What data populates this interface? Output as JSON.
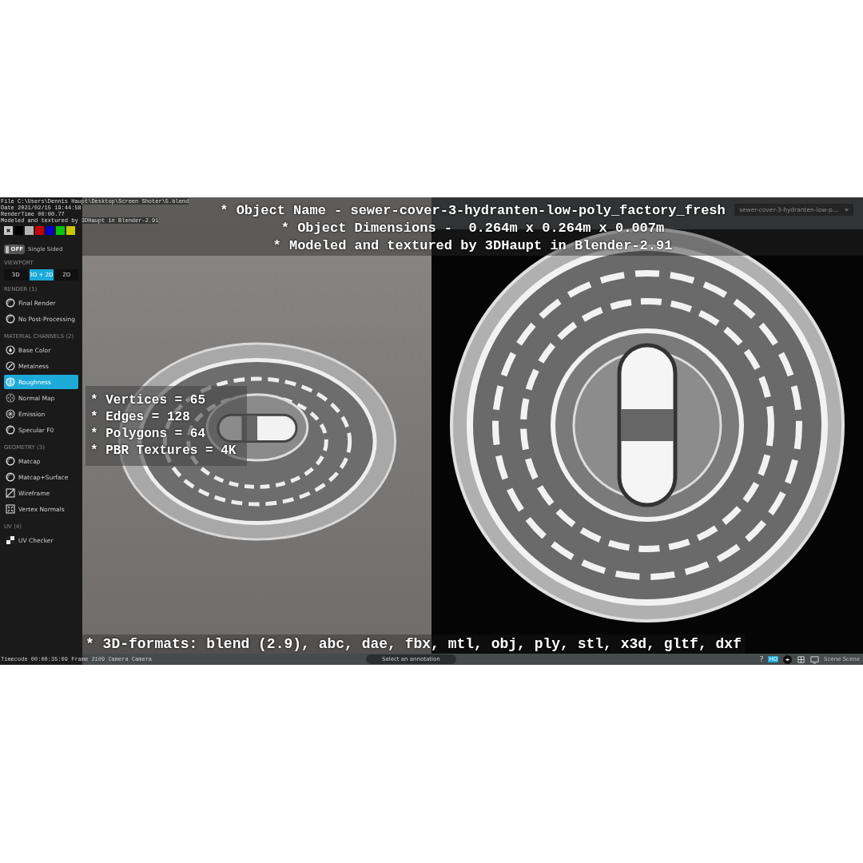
{
  "file_info": [
    "File C:\\Users\\Dennis Haupt\\Desktop\\Screen Shoter\\5.blend",
    "Date 2021/02/15 19:44:58",
    "RenderTime 00:00.77",
    "Modeled and textured by 3DHaupt in Blender-2.91"
  ],
  "sidebar": {
    "swatches": [
      {
        "kind": "close",
        "color": "#c8c8c8"
      },
      {
        "kind": "color",
        "color": "#000000"
      },
      {
        "kind": "color",
        "color": "#b4b4b4"
      },
      {
        "kind": "color",
        "color": "#c80000"
      },
      {
        "kind": "color",
        "color": "#0000c8"
      },
      {
        "kind": "color",
        "color": "#00c800"
      },
      {
        "kind": "color",
        "color": "#c8c800"
      }
    ],
    "toggle": {
      "label": "OFF",
      "on": false,
      "text": "Single Sided"
    },
    "sections": [
      {
        "heading": "VIEWPORT",
        "kind": "segmented",
        "items": [
          {
            "label": "3D",
            "selected": false
          },
          {
            "label": "3D + 2D",
            "selected": true
          },
          {
            "label": "2D",
            "selected": false
          }
        ]
      },
      {
        "heading": "RENDER (1)",
        "kind": "list",
        "items": [
          {
            "label": "Final Render",
            "kind": "ring",
            "selected": false
          },
          {
            "label": "No Post-Processing",
            "kind": "ring",
            "selected": false
          }
        ]
      },
      {
        "heading": "MATERIAL CHANNELS (2)",
        "kind": "list",
        "items": [
          {
            "label": "Base Color",
            "kind": "drop",
            "selected": false
          },
          {
            "label": "Metalness",
            "kind": "compass",
            "selected": false
          },
          {
            "label": "Roughness",
            "kind": "globe",
            "selected": true
          },
          {
            "label": "Normal Map",
            "kind": "dots",
            "selected": false
          },
          {
            "label": "Emission",
            "kind": "flower",
            "selected": false
          },
          {
            "label": "Specular F0",
            "kind": "ring",
            "selected": false
          }
        ]
      },
      {
        "heading": "GEOMETRY (3)",
        "kind": "list",
        "items": [
          {
            "label": "Matcap",
            "kind": "ring",
            "selected": false
          },
          {
            "label": "Matcap+Surface",
            "kind": "ring",
            "selected": false
          },
          {
            "label": "Wireframe",
            "kind": "diagonal",
            "selected": false
          },
          {
            "label": "Vertex Normals",
            "kind": "corners",
            "selected": false
          }
        ]
      },
      {
        "heading": "UV (4)",
        "kind": "list",
        "items": [
          {
            "label": "UV Checker",
            "kind": "checker",
            "selected": false
          }
        ]
      }
    ],
    "timecode": "Timecode 00:00:35:09   Frame 2109   Camera Camera"
  },
  "title_lines": [
    "* Object Name - sewer-cover-3-hydranten-low-poly_factory_fresh",
    "* Object Dimensions -  0.264m x 0.264m x 0.007m",
    "* Modeled and textured by 3DHaupt in Blender-2.91"
  ],
  "stats": [
    "* Vertices = 65",
    "* Edges = 128",
    "* Polygons = 64",
    "* PBR Textures = 4K"
  ],
  "formats_line": "* 3D-formats: blend (2.9), abc, dae, fbx, mtl, obj, ply, stl, x3d, gltf, dxf",
  "model_select": {
    "value": "sewer-cover-3-hydranten-low-p..."
  },
  "bottom_bar": {
    "annotation": "Select an annotation",
    "help": "?",
    "hd_badge": "HD",
    "scene_label": "Scene Scene"
  }
}
